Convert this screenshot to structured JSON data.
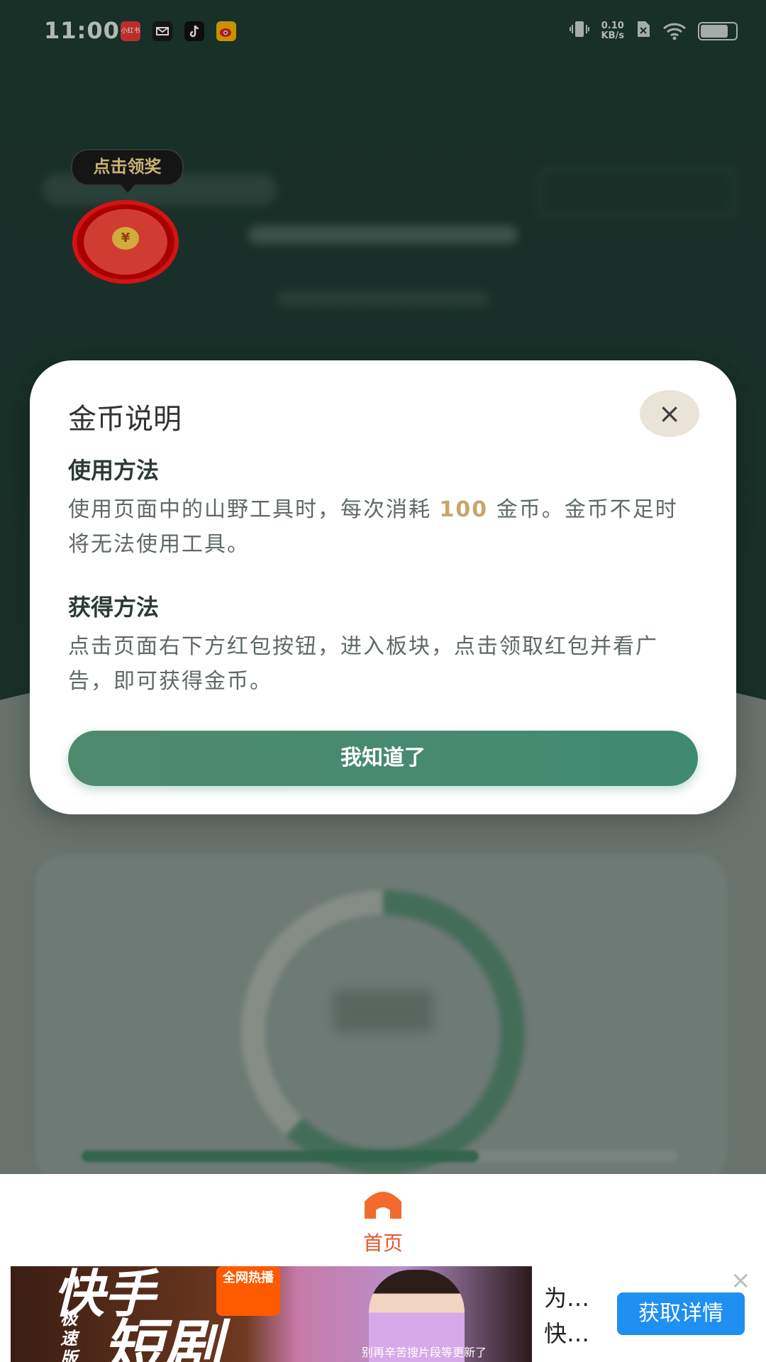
{
  "status_bar": {
    "time": "11:00",
    "net_speed": "0.10",
    "net_unit": "KB/s",
    "app_icons": [
      "xiaohongshu-icon",
      "mail-icon",
      "tiktok-icon",
      "weibo-icon"
    ]
  },
  "floating_reward": {
    "bubble_text": "点击领奖",
    "coin_symbol": "¥"
  },
  "modal": {
    "title": "金币说明",
    "close_symbol": "×",
    "sections": [
      {
        "title": "使用方法",
        "text_before": "使用页面中的山野工具时，每次消耗 ",
        "highlight": "100",
        "text_after": " 金币。金币不足时将无法使用工具。"
      },
      {
        "title": "获得方法",
        "text": "点击页面右下方红包按钮，进入板块，点击领取红包并看广告，即可获得金币。"
      }
    ],
    "confirm_label": "我知道了"
  },
  "bottom_nav": {
    "items": [
      {
        "label": "首页",
        "icon": "home-icon",
        "active": true
      }
    ],
    "active_color": "#e8562a"
  },
  "ad": {
    "brand_line1": "快手",
    "brand_line2": "短剧",
    "brand_sub": "极速版",
    "badge": "全网热播",
    "caption": "别再辛苦搜片段等更新了",
    "text_line1": "为…",
    "text_line2": "快…",
    "cta_label": "获取详情",
    "close_symbol": "×"
  },
  "colors": {
    "primary_green": "#3f8a72",
    "highlight_gold": "#c6a66a",
    "cta_blue": "#1f8ff2"
  }
}
